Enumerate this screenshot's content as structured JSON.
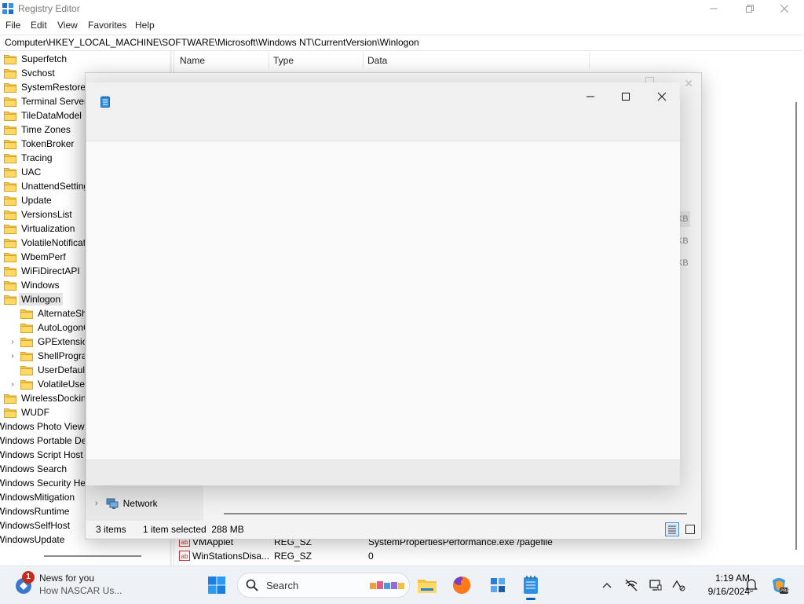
{
  "registry": {
    "title": "Registry Editor",
    "menu": [
      "File",
      "Edit",
      "View",
      "Favorites",
      "Help"
    ],
    "address": "Computer\\HKEY_LOCAL_MACHINE\\SOFTWARE\\Microsoft\\Windows NT\\CurrentVersion\\Winlogon",
    "tree": [
      {
        "label": "Superfetch",
        "indent": 0
      },
      {
        "label": "Svchost",
        "indent": 0
      },
      {
        "label": "SystemRestore",
        "indent": 0
      },
      {
        "label": "Terminal Server",
        "indent": 0
      },
      {
        "label": "TileDataModel",
        "indent": 0
      },
      {
        "label": "Time Zones",
        "indent": 0
      },
      {
        "label": "TokenBroker",
        "indent": 0
      },
      {
        "label": "Tracing",
        "indent": 0
      },
      {
        "label": "UAC",
        "indent": 0
      },
      {
        "label": "UnattendSettings",
        "indent": 0
      },
      {
        "label": "Update",
        "indent": 0
      },
      {
        "label": "VersionsList",
        "indent": 0
      },
      {
        "label": "Virtualization",
        "indent": 0
      },
      {
        "label": "VolatileNotifications",
        "indent": 0
      },
      {
        "label": "WbemPerf",
        "indent": 0
      },
      {
        "label": "WiFiDirectAPI",
        "indent": 0
      },
      {
        "label": "Windows",
        "indent": 0
      },
      {
        "label": "Winlogon",
        "indent": 0,
        "selected": true,
        "open": true
      },
      {
        "label": "AlternateShells",
        "indent": 1
      },
      {
        "label": "AutoLogonChecked",
        "indent": 1
      },
      {
        "label": "GPExtensions",
        "indent": 1,
        "expander": true
      },
      {
        "label": "ShellPrograms",
        "indent": 1,
        "expander": true
      },
      {
        "label": "UserDefaults",
        "indent": 1
      },
      {
        "label": "VolatileUserMgrKey",
        "indent": 1,
        "expander": true
      },
      {
        "label": "WirelessDocking",
        "indent": 0
      },
      {
        "label": "WUDF",
        "indent": 0
      },
      {
        "label": "Windows Photo Viewer",
        "indent": -1
      },
      {
        "label": "Windows Portable Devices",
        "indent": -1
      },
      {
        "label": "Windows Script Host",
        "indent": -1
      },
      {
        "label": "Windows Search",
        "indent": -1
      },
      {
        "label": "Windows Security Health",
        "indent": -1
      },
      {
        "label": "WindowsMitigation",
        "indent": -1
      },
      {
        "label": "WindowsRuntime",
        "indent": -1
      },
      {
        "label": "WindowsSelfHost",
        "indent": -1
      },
      {
        "label": "WindowsUpdate",
        "indent": -1
      }
    ],
    "columns": {
      "name": "Name",
      "type": "Type",
      "data": "Data"
    },
    "rows": [
      {
        "name": "VMApplet",
        "type": "REG_SZ",
        "data": "SystemPropertiesPerformance.exe /pagefile"
      },
      {
        "name": "WinStationsDisa...",
        "type": "REG_SZ",
        "data": "0"
      }
    ],
    "ghost_kb": [
      "KB",
      "KB",
      "KB"
    ]
  },
  "explorer": {
    "network_label": "Network",
    "status_items": "3 items",
    "status_selected": "1 item selected  288 MB"
  },
  "taskbar": {
    "news_title": "News for you",
    "news_sub": "How NASCAR Us...",
    "news_badge": "1",
    "search_label": "Search",
    "time": "1:19 AM",
    "date": "9/16/2024"
  }
}
